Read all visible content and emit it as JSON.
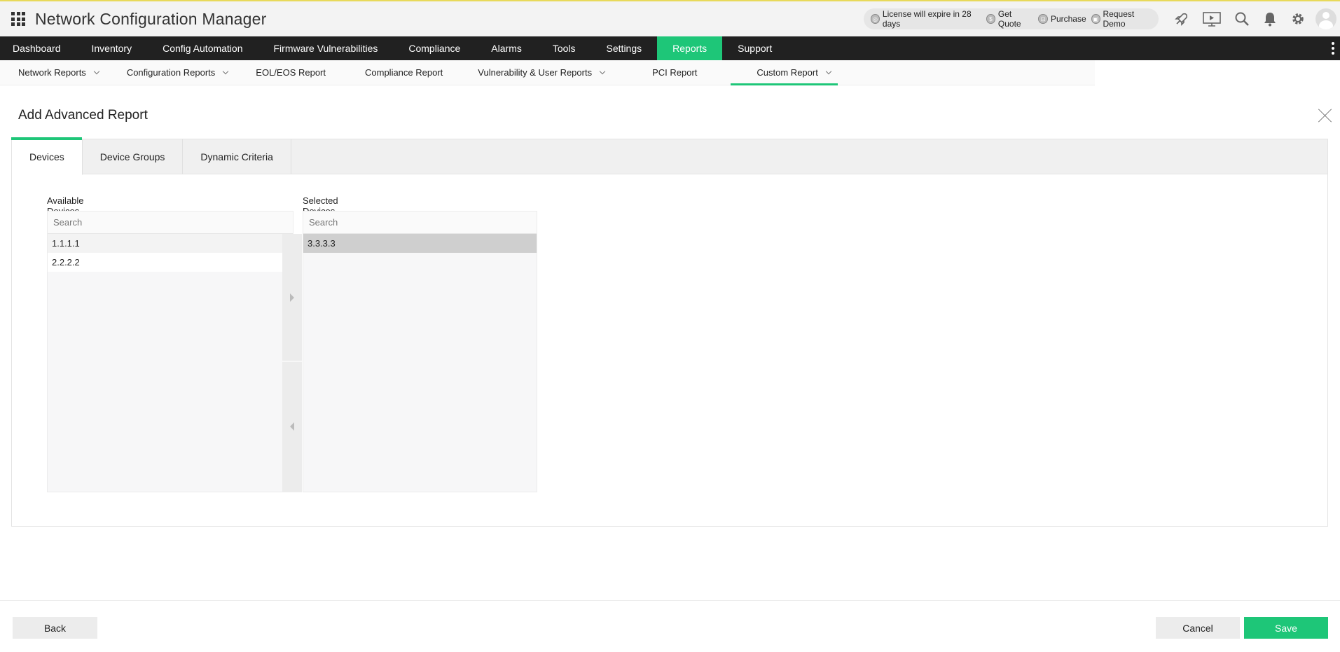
{
  "app": {
    "title": "Network Configuration Manager"
  },
  "header": {
    "links": [
      {
        "label": "License will expire in 28 days",
        "icon": "license-icon"
      },
      {
        "label": "Get Quote",
        "icon": "dollar-icon"
      },
      {
        "label": "Purchase",
        "icon": "cart-icon"
      },
      {
        "label": "Request Demo",
        "icon": "demo-icon"
      }
    ],
    "icons": [
      "rocket-icon",
      "presentation-icon",
      "search-icon",
      "bell-icon",
      "gear-icon",
      "avatar"
    ]
  },
  "mainnav": {
    "items": [
      {
        "label": "Dashboard"
      },
      {
        "label": "Inventory"
      },
      {
        "label": "Config Automation"
      },
      {
        "label": "Firmware Vulnerabilities"
      },
      {
        "label": "Compliance"
      },
      {
        "label": "Alarms"
      },
      {
        "label": "Tools"
      },
      {
        "label": "Settings"
      },
      {
        "label": "Reports"
      },
      {
        "label": "Support"
      }
    ],
    "active": "Reports",
    "accent": "#1ec678"
  },
  "subnav": {
    "items": [
      {
        "label": "Network Reports"
      },
      {
        "label": "Configuration Reports"
      },
      {
        "label": "EOL/EOS Report"
      },
      {
        "label": "Compliance Report"
      },
      {
        "label": "Vulnerability & User Reports"
      },
      {
        "label": "PCI Report"
      },
      {
        "label": "Custom Report"
      }
    ],
    "active": "Custom Report"
  },
  "page": {
    "title": "Add Advanced Report"
  },
  "tabs": [
    {
      "label": "Devices"
    },
    {
      "label": "Device Groups"
    },
    {
      "label": "Dynamic Criteria"
    }
  ],
  "active_tab": "Devices",
  "available": {
    "label": "Available Devices",
    "search_placeholder": "Search",
    "items": [
      "1.1.1.1",
      "2.2.2.2"
    ]
  },
  "selected": {
    "label": "Selected Devices",
    "search_placeholder": "Search",
    "items": [
      "3.3.3.3"
    ]
  },
  "footer": {
    "back_label": "Back",
    "cancel_label": "Cancel",
    "save_label": "Save"
  }
}
